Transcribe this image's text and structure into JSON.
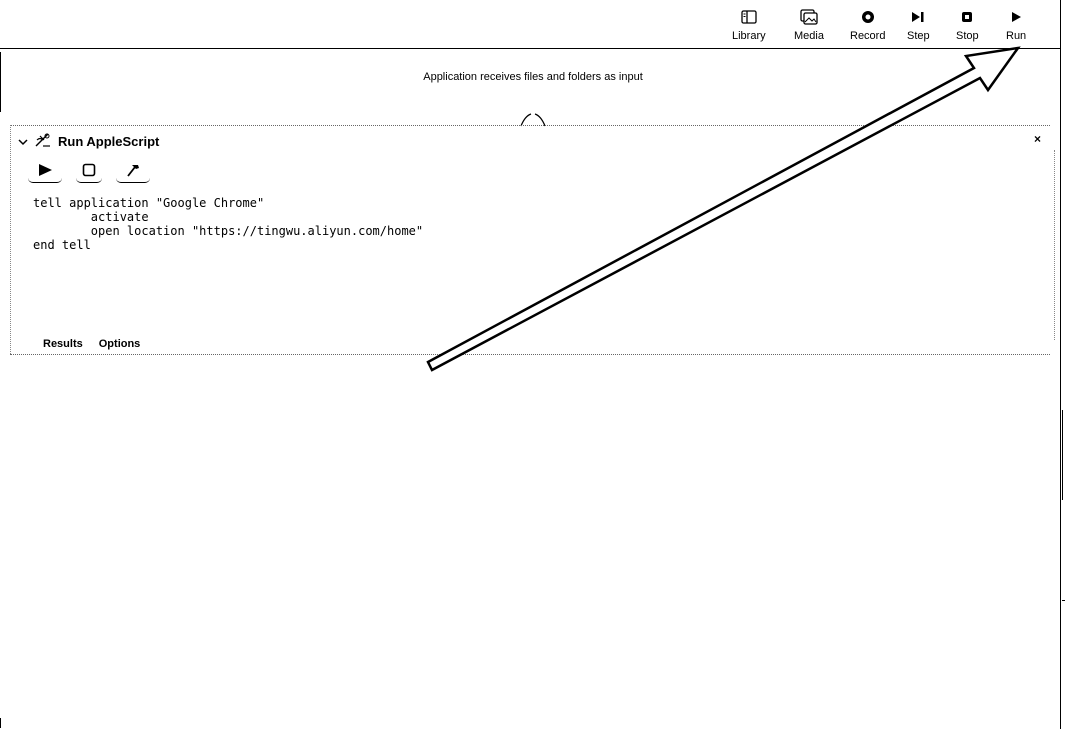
{
  "toolbar": {
    "library": "Library",
    "media": "Media",
    "record": "Record",
    "step": "Step",
    "stop": "Stop",
    "run": "Run"
  },
  "workflow": {
    "input_description": "Application receives files and folders as input"
  },
  "action": {
    "title": "Run AppleScript",
    "close_symbol": "×",
    "script_lines": [
      "tell application \"Google Chrome\"",
      "\tactivate",
      "\topen location \"https://tingwu.aliyun.com/home\"",
      "end tell"
    ],
    "tabs": {
      "results": "Results",
      "options": "Options"
    }
  },
  "icons": {
    "library": "library-icon",
    "media": "media-icon",
    "record": "record-icon",
    "step": "step-icon",
    "stop": "stop-icon",
    "run": "run-icon",
    "collapse": "chevron-down-icon",
    "applescript": "applescript-icon",
    "script_run": "play-icon",
    "script_stop": "stop-icon",
    "script_compile": "hammer-icon",
    "annotation_arrow": "arrow-annotation-icon"
  }
}
